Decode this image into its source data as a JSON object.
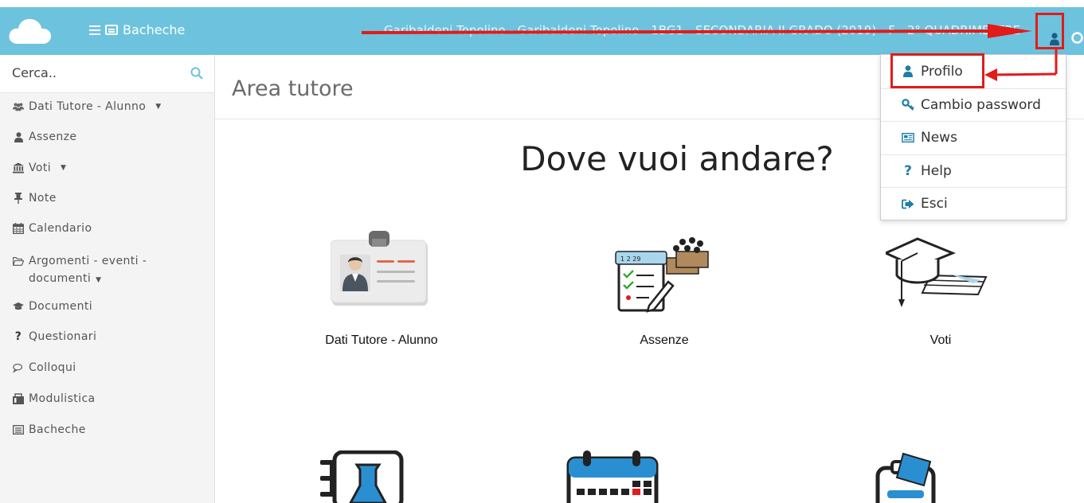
{
  "header": {
    "menu_label": "Bacheche",
    "info_text": "Garibaldeni Topolino - Garibaldeni Topolino - 1BG1 - SECONDARIA II GRADO (2019) - F - 2° QUADRIMESTRE"
  },
  "sidebar": {
    "search_placeholder": "Cerca..",
    "items": [
      {
        "label": "Dati Tutore - Alunno",
        "icon": "users-icon",
        "has_caret": true
      },
      {
        "label": "Assenze",
        "icon": "user-icon"
      },
      {
        "label": "Voti",
        "icon": "bank-icon",
        "has_caret": true
      },
      {
        "label": "Note",
        "icon": "pin-icon"
      },
      {
        "label": "Calendario",
        "icon": "calendar-icon"
      },
      {
        "label": "Argomenti - eventi - documenti",
        "icon": "folder-open-icon",
        "has_caret": true
      },
      {
        "label": "Documenti",
        "icon": "graduation-cap-icon"
      },
      {
        "label": "Questionari",
        "icon": "question-icon"
      },
      {
        "label": "Colloqui",
        "icon": "comments-icon"
      },
      {
        "label": "Modulistica",
        "icon": "briefcase-icon"
      },
      {
        "label": "Bacheche",
        "icon": "board-icon"
      }
    ]
  },
  "main": {
    "title": "Area tutore",
    "heading": "Dove vuoi andare?",
    "tiles": [
      {
        "label": "Dati Tutore - Alunno",
        "icon": "id-card-icon"
      },
      {
        "label": "Assenze",
        "icon": "attendance-clipboard-icon"
      },
      {
        "label": "Voti",
        "icon": "graduation-diploma-icon"
      },
      {
        "label": "",
        "icon": "lab-notebook-icon"
      },
      {
        "label": "",
        "icon": "calendar-icon"
      },
      {
        "label": "",
        "icon": "event-ticket-icon"
      }
    ]
  },
  "user_menu": {
    "items": [
      {
        "label": "Profilo",
        "icon": "user-icon"
      },
      {
        "label": "Cambio password",
        "icon": "key-icon"
      },
      {
        "label": "News",
        "icon": "newspaper-icon"
      },
      {
        "label": "Help",
        "icon": "question-icon"
      },
      {
        "label": "Esci",
        "icon": "sign-out-icon"
      }
    ]
  },
  "colors": {
    "topbar": "#6dc3dd",
    "annotation": "#e21b1b",
    "menu_icon": "#1f7da6"
  }
}
